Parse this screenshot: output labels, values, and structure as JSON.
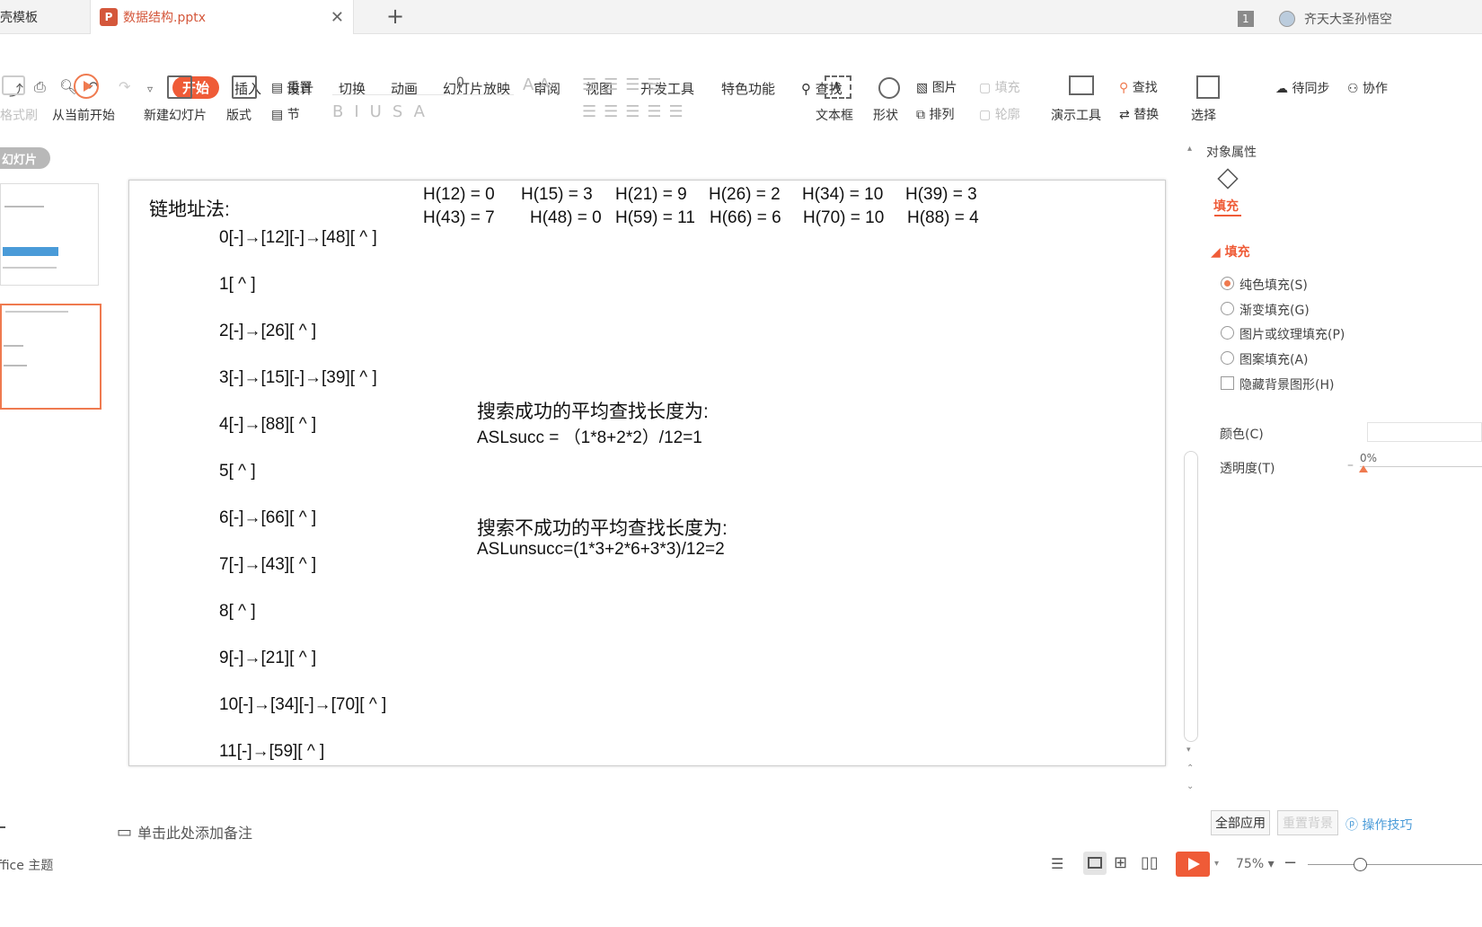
{
  "titlebar": {
    "template_tab": "稻壳模板",
    "doc_tab": "数据结构.pptx",
    "page_badge": "1",
    "user_name": "齐天大圣孙悟空"
  },
  "menu": {
    "start": "开始",
    "items": [
      "插入",
      "设计",
      "切换",
      "动画",
      "幻灯片放映",
      "审阅",
      "视图",
      "开发工具",
      "特色功能"
    ],
    "search": "查找",
    "sync": "待同步",
    "collab": "协作"
  },
  "ribbon": {
    "format_painter": "格式刷",
    "from_current": "从当前开始",
    "new_slide": "新建幻灯片",
    "layout": "版式",
    "reset": "重置",
    "section": "节",
    "font_size": "0",
    "textbox": "文本框",
    "shape": "形状",
    "picture": "图片",
    "fill": "填充",
    "arrange": "排列",
    "outline": "轮廓",
    "present_tools": "演示工具",
    "find": "查找",
    "replace": "替换",
    "select": "选择"
  },
  "left_panel": {
    "slides_tab": "幻灯片"
  },
  "slide": {
    "title": "链地址法:",
    "hash_row1": [
      "H(12) = 0",
      "H(15) = 3",
      "H(21) = 9",
      "H(26) = 2",
      "H(34) = 10",
      "H(39) = 3"
    ],
    "hash_row2": [
      "H(43) = 7",
      "H(48) = 0",
      "H(59) = 11",
      "H(66) = 6",
      "H(70) = 10",
      "H(88) = 4"
    ],
    "chains": [
      "0[-]→[12][-]→[48][ ^ ]",
      "1[ ^ ]",
      "2[-]→[26][ ^ ]",
      "3[-]→[15][-]→[39][ ^ ]",
      "4[-]→[88][ ^ ]",
      "5[ ^ ]",
      "6[-]→[66][ ^ ]",
      "7[-]→[43][ ^ ]",
      "8[ ^ ]",
      "9[-]→[21][ ^ ]",
      "10[-]→[34][-]→[70][ ^ ]",
      "11[-]→[59][ ^ ]"
    ],
    "succ_heading": "搜索成功的平均查找长度为:",
    "succ_formula": "ASLsucc = （1*8+2*2）/12=1",
    "unsucc_heading": "搜索不成功的平均查找长度为:",
    "unsucc_formula": "ASLunsucc=(1*3+2*6+3*3)/12=2"
  },
  "right_panel": {
    "title": "对象属性",
    "fill_tab": "填充",
    "fill_section": "填充",
    "options": [
      "纯色填充(S)",
      "渐变填充(G)",
      "图片或纹理填充(P)",
      "图案填充(A)"
    ],
    "hide_bg": "隐藏背景图形(H)",
    "color_label": "颜色(C)",
    "transparency_label": "透明度(T)",
    "transparency_value": "0%",
    "apply_all": "全部应用",
    "reset_bg": "重置背景",
    "tips": "操作技巧"
  },
  "status": {
    "notes_placeholder": "单击此处添加备注",
    "theme": "Office 主题",
    "zoom": "75%"
  },
  "colors": {
    "accent": "#ef5b37",
    "selected_thumb": "#ef7a4f"
  }
}
